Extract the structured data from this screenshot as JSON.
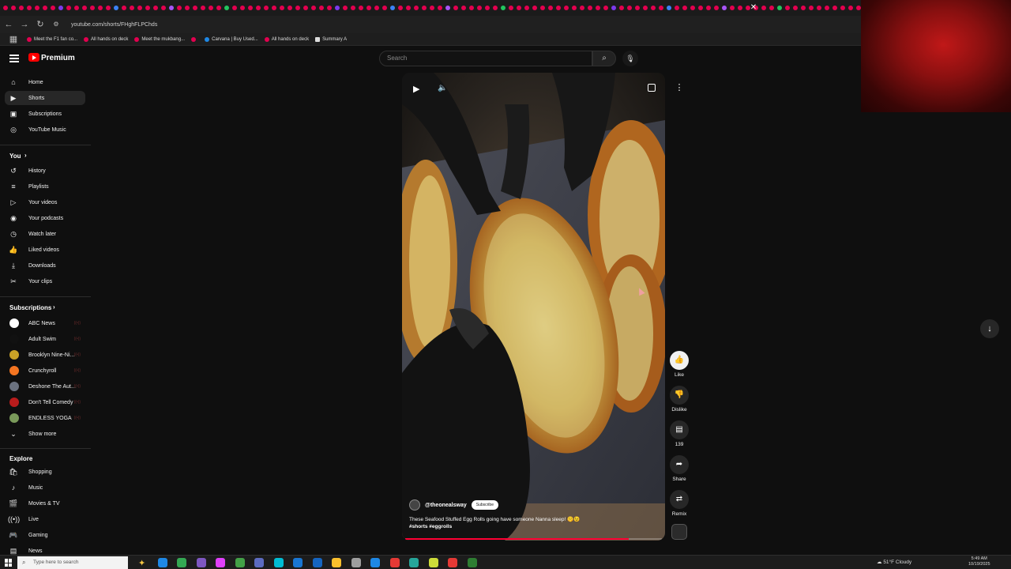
{
  "browser": {
    "tab_favicon_colors": [
      "#e3004f",
      "#a855f7",
      "#7c3aed",
      "#22c55e",
      "#3b82f6"
    ],
    "close_tab_glyph": "✕",
    "url": "youtube.com/shorts/FHghFLPChds",
    "bookmarks": [
      {
        "label": "Meet the F1 fan co...",
        "icon": "youtube-icon"
      },
      {
        "label": "All hands on deck",
        "icon": "youtube-icon"
      },
      {
        "label": "Meet the mukbang...",
        "icon": "youtube-icon"
      },
      {
        "label": "",
        "icon": "youtube-icon"
      },
      {
        "label": "Carvana | Buy Used...",
        "icon": "carvana-icon"
      },
      {
        "label": "All hands on deck",
        "icon": "youtube-icon"
      },
      {
        "label": "Summary A",
        "icon": "page-icon"
      }
    ]
  },
  "header": {
    "brand": "Premium",
    "search_placeholder": "Search"
  },
  "sidebar": {
    "main": [
      {
        "label": "Home",
        "icon": "home-icon",
        "glyph": "⌂",
        "active": false
      },
      {
        "label": "Shorts",
        "icon": "shorts-icon",
        "glyph": "▶",
        "active": true
      },
      {
        "label": "Subscriptions",
        "icon": "subscriptions-icon",
        "glyph": "▣",
        "active": false
      },
      {
        "label": "YouTube Music",
        "icon": "music-disc-icon",
        "glyph": "◎",
        "active": false
      }
    ],
    "you_heading": "You",
    "you": [
      {
        "label": "History",
        "icon": "history-icon",
        "glyph": "↺"
      },
      {
        "label": "Playlists",
        "icon": "playlists-icon",
        "glyph": "≡"
      },
      {
        "label": "Your videos",
        "icon": "your-videos-icon",
        "glyph": "▷"
      },
      {
        "label": "Your podcasts",
        "icon": "podcast-icon",
        "glyph": "◉"
      },
      {
        "label": "Watch later",
        "icon": "clock-icon",
        "glyph": "◷"
      },
      {
        "label": "Liked videos",
        "icon": "thumbs-up-icon",
        "glyph": "👍"
      },
      {
        "label": "Downloads",
        "icon": "download-icon",
        "glyph": "⤓"
      },
      {
        "label": "Your clips",
        "icon": "scissors-icon",
        "glyph": "✂"
      }
    ],
    "subs_heading": "Subscriptions",
    "subscriptions": [
      {
        "label": "ABC News",
        "color": "#ffffff"
      },
      {
        "label": "Adult Swim",
        "color": "#111111"
      },
      {
        "label": "Brooklyn Nine-Ni...",
        "color": "#c9a227"
      },
      {
        "label": "Crunchyroll",
        "color": "#f47521"
      },
      {
        "label": "Deshone The Aut...",
        "color": "#6b7280"
      },
      {
        "label": "Don't Tell Comedy",
        "color": "#b91c1c"
      },
      {
        "label": "ENDLESS YOGA",
        "color": "#7a9a5a"
      }
    ],
    "show_more": "Show more",
    "explore_heading": "Explore",
    "explore": [
      {
        "label": "Shopping",
        "icon": "shopping-bag-icon",
        "glyph": "🛍"
      },
      {
        "label": "Music",
        "icon": "music-note-icon",
        "glyph": "♪"
      },
      {
        "label": "Movies & TV",
        "icon": "film-icon",
        "glyph": "🎬"
      },
      {
        "label": "Live",
        "icon": "live-icon",
        "glyph": "((•))"
      },
      {
        "label": "Gaming",
        "icon": "gamepad-icon",
        "glyph": "🎮"
      },
      {
        "label": "News",
        "icon": "news-icon",
        "glyph": "▤"
      }
    ]
  },
  "short": {
    "channel": "@theonealsway",
    "subscribe": "Subscribe",
    "caption": "These Seafood Stuffed Egg Rolls going have someone Nanna sleep! 🤫😉",
    "tags": "#shorts #eggrolls",
    "progress": 0.87
  },
  "actions": {
    "like": "Like",
    "dislike": "Dislike",
    "comments": "139",
    "share": "Share",
    "remix": "Remix"
  },
  "taskbar": {
    "search_placeholder": "Type here to search",
    "weather": "51°F  Cloudy",
    "time": "5:49 AM",
    "date": "10/19/2025",
    "app_icon_colors": [
      "#f5c542",
      "#1e88e5",
      "#34a853",
      "#7e57c2",
      "#e040fb",
      "#43a047",
      "#5c6bc0",
      "#00bcd4",
      "#1976d2",
      "#1565c0",
      "#fbc02d",
      "#9e9e9e",
      "#1e88e5",
      "#e53935",
      "#26a69a",
      "#cddc39",
      "#e53935",
      "#2e7d32"
    ]
  }
}
